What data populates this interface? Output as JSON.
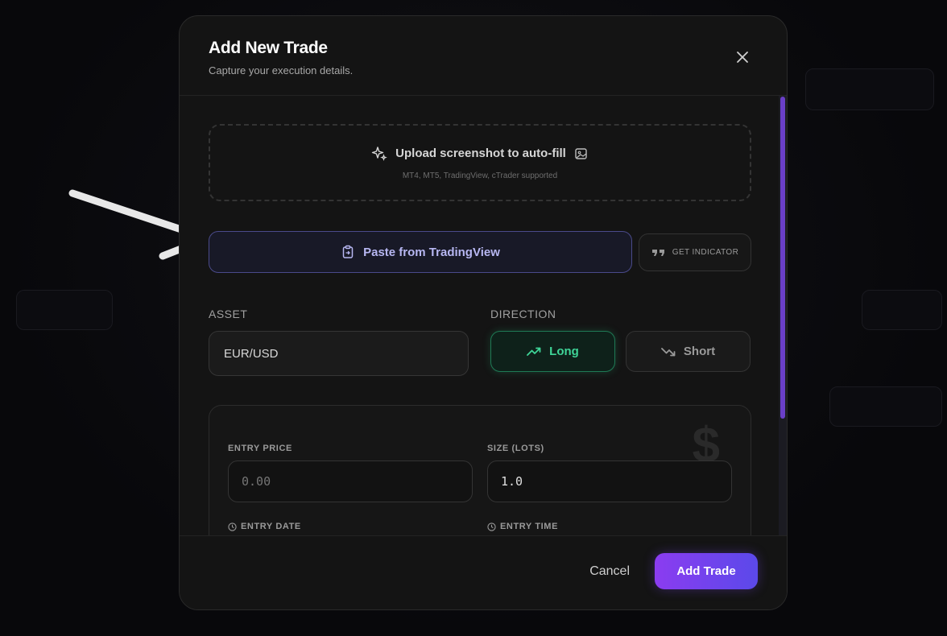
{
  "modal": {
    "title": "Add New Trade",
    "subtitle": "Capture your execution details.",
    "close_icon": "close-icon"
  },
  "upload": {
    "label": "Upload screenshot to auto-fill",
    "hint": "MT4, MT5, TradingView, cTrader supported",
    "leading_icon": "sparkles-icon",
    "trailing_icon": "image-icon"
  },
  "paste": {
    "label": "Paste from TradingView",
    "icon": "clipboard-icon"
  },
  "indicator": {
    "label": "GET INDICATOR",
    "icon": "quote-icon"
  },
  "asset": {
    "label": "ASSET",
    "value": "EUR/USD"
  },
  "direction": {
    "label": "DIRECTION",
    "long_label": "Long",
    "short_label": "Short",
    "selected": "Long"
  },
  "pricing": {
    "entry_price_label": "ENTRY PRICE",
    "entry_price_placeholder": "0.00",
    "size_label": "SIZE (LOTS)",
    "size_value": "1.0",
    "entry_date_label": "ENTRY DATE",
    "entry_time_label": "ENTRY TIME"
  },
  "footer": {
    "cancel_label": "Cancel",
    "add_label": "Add Trade"
  },
  "colors": {
    "accent_purple": "#8b3cf0",
    "long_green": "#3fd598",
    "paste_blue": "#b7b7f2"
  }
}
